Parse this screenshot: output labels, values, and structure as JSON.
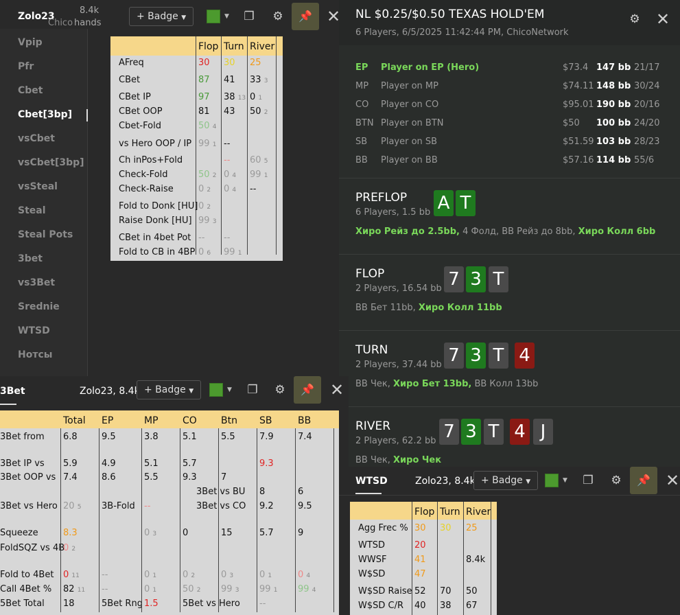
{
  "hud_top": {
    "player": "Zolo23",
    "site": "Chico",
    "hands": "8.4k",
    "hands_label": "hands",
    "badge": "+ Badge"
  },
  "sidebar": {
    "items": [
      "Vpip",
      "Pfr",
      "Cbet",
      "Cbet[3bp]",
      "vsCbet",
      "vsCbet[3bp]",
      "vsSteal",
      "Steal",
      "Steal Pots",
      "3bet",
      "vs3Bet",
      "Srednie",
      "WTSD",
      "Нотсы"
    ],
    "active": "Cbet[3bp]"
  },
  "postflop_table": {
    "headers": [
      "Flop",
      "Turn",
      "River"
    ],
    "rows": [
      {
        "label": "AFreq",
        "flop": "30",
        "turn": "30",
        "river": "25"
      },
      {
        "label": "CBet",
        "flop": "87",
        "turn": "41",
        "river": "33",
        "river_n": "3"
      },
      {
        "label": "CBet IP",
        "flop": "97",
        "turn": "38",
        "turn_n": "13",
        "river": "0",
        "river_n": "1"
      },
      {
        "label": "CBet OOP",
        "flop": "81",
        "turn": "43",
        "river": "50",
        "river_n": "2"
      },
      {
        "label": "Cbet-Fold",
        "flop": "50",
        "flop_n": "4",
        "turn": "",
        "river": ""
      },
      {
        "label": "vs Hero OOP / IP",
        "flop": "99",
        "flop_n": "1",
        "turn": "--",
        "river": ""
      },
      {
        "label": "Ch inPos+Fold",
        "flop": "",
        "turn": "--",
        "river": "60",
        "river_n": "5"
      },
      {
        "label": "Check-Fold",
        "flop": "50",
        "flop_n": "2",
        "turn": "0",
        "turn_n": "4",
        "river": "99",
        "river_n": "1"
      },
      {
        "label": "Check-Raise",
        "flop": "0",
        "flop_n": "2",
        "turn": "0",
        "turn_n": "4",
        "river": "--"
      },
      {
        "label": "Fold to Donk [HU]",
        "flop": "0",
        "flop_n": "2",
        "turn": "",
        "river": ""
      },
      {
        "label": "Raise Donk [HU]",
        "flop": "99",
        "flop_n": "3",
        "turn": "",
        "river": ""
      },
      {
        "label": "CBet in 4bet Pot",
        "flop": "--",
        "turn": "--",
        "river": ""
      },
      {
        "label": "Fold to CB in 4BP",
        "flop": "0",
        "flop_n": "6",
        "turn": "99",
        "turn_n": "1",
        "river": ""
      }
    ]
  },
  "hand": {
    "title": "NL $0.25/$0.50 TEXAS HOLD'EM",
    "subtitle": "6 Players, 6/5/2025 11:42:44 PM, ChicoNetwork",
    "players": [
      {
        "pos": "EP",
        "name": "Player on EP (Hero)",
        "stack": "$73.4",
        "bb": "147 bb",
        "stat": "21/17",
        "hero": true
      },
      {
        "pos": "MP",
        "name": "Player on MP",
        "stack": "$74.11",
        "bb": "148 bb",
        "stat": "30/24"
      },
      {
        "pos": "CO",
        "name": "Player on CO",
        "stack": "$95.01",
        "bb": "190 bb",
        "stat": "20/16"
      },
      {
        "pos": "BTN",
        "name": "Player on BTN",
        "stack": "$50",
        "bb": "100 bb",
        "stat": "24/20"
      },
      {
        "pos": "SB",
        "name": "Player on SB",
        "stack": "$51.59",
        "bb": "103 bb",
        "stat": "28/23"
      },
      {
        "pos": "BB",
        "name": "Player on BB",
        "stack": "$57.16",
        "bb": "114 bb",
        "stat": "55/6"
      }
    ],
    "streets": [
      {
        "name": "PREFLOP",
        "info": "6 Players, 1.5 bb",
        "cards": [
          "A",
          "T"
        ],
        "a1": "Хиро Рейз до 2.5bb,",
        "a2": " 4 Фолд, BB Рейз до 8bb, ",
        "a3": "Хиро Колл 6bb",
        "a4": ""
      },
      {
        "name": "FLOP",
        "info": "2 Players, 16.54 bb",
        "cards": [
          "7",
          "3",
          "T"
        ],
        "a1": "",
        "a2": "BB Бет 11bb, ",
        "a3": "Хиро Колл 11bb",
        "a4": ""
      },
      {
        "name": "TURN",
        "info": "2 Players, 37.44 bb",
        "cards": [
          "7",
          "3",
          "T",
          "4"
        ],
        "a1": "",
        "a2": "BB Чек, ",
        "a3": "Хиро Бет 13bb,",
        "a4": " BB Колл 13bb"
      },
      {
        "name": "RIVER",
        "info": "2 Players, 62.2 bb",
        "cards": [
          "7",
          "3",
          "T",
          "4",
          "J"
        ],
        "a1": "",
        "a2": "BB Чек, ",
        "a3": "Хиро Чек",
        "a4": ""
      }
    ]
  },
  "panel_3bet": {
    "tab": "3Bet",
    "player": "Zolo23, 8.4k",
    "badge": "+ Badge",
    "headers": [
      "Total",
      "EP",
      "MP",
      "CO",
      "Btn",
      "SB",
      "BB"
    ]
  },
  "panel_wtsd": {
    "tab": "WTSD",
    "player": "Zolo23, 8.4k",
    "badge": "+ Badge",
    "headers": [
      "Flop",
      "Turn",
      "River"
    ],
    "rows": [
      {
        "label": "Agg Frec %",
        "flop": "30",
        "turn": "30",
        "river": "25"
      },
      {
        "label": "WTSD",
        "flop": "20",
        "turn": "",
        "river": ""
      },
      {
        "label": "WWSF",
        "flop": "41",
        "turn": "",
        "river": "8.4k"
      },
      {
        "label": "W$SD",
        "flop": "47",
        "turn": "",
        "river": ""
      },
      {
        "label": "W$SD Raise",
        "flop": "52",
        "turn": "70",
        "river": "50"
      },
      {
        "label": "W$SD C/R",
        "flop": "40",
        "turn": "38",
        "river": "67"
      }
    ]
  },
  "colors": {
    "header_bg": "#f6d78a",
    "table_bg": "#d7d7d7",
    "hero_green": "#7ad85a",
    "card_green": "#1f7a1f",
    "card_red": "#8a1a14"
  },
  "icons": [
    "copy-icon",
    "gear-icon",
    "pin-icon",
    "close-icon",
    "caret-down-icon"
  ]
}
